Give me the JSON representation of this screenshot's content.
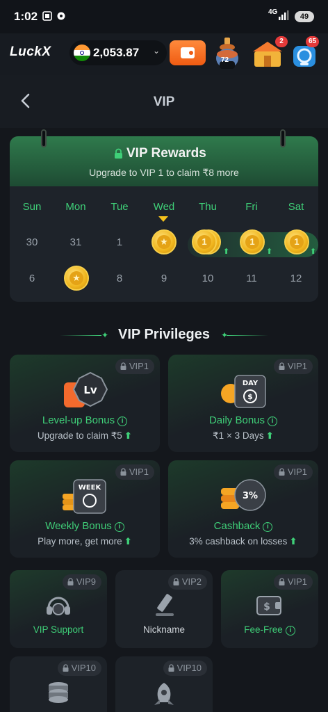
{
  "status_bar": {
    "time": "1:02",
    "network": "4G",
    "battery": "49"
  },
  "header": {
    "logo": "LuckX",
    "balance": "2,053.87",
    "level": "72",
    "gift_badge": "2",
    "support_badge": "65"
  },
  "nav": {
    "title": "VIP"
  },
  "rewards": {
    "title": "VIP Rewards",
    "subtitle": "Upgrade to VIP 1 to claim ₹8 more",
    "days": [
      "Sun",
      "Mon",
      "Tue",
      "Wed",
      "Thu",
      "Fri",
      "Sat"
    ],
    "week1": [
      "30",
      "31",
      "1"
    ],
    "week2": [
      "6",
      "8",
      "9",
      "10",
      "11",
      "12"
    ],
    "coin_values": [
      "1",
      "1",
      "1"
    ]
  },
  "privileges": {
    "title": "VIP Privileges",
    "cards": [
      {
        "name": "Level-up Bonus",
        "desc": "Upgrade to claim ₹5",
        "vip": "VIP1",
        "art": "Lv"
      },
      {
        "name": "Daily Bonus",
        "desc": "₹1 × 3 Days",
        "vip": "VIP1",
        "art": "DAY"
      },
      {
        "name": "Weekly Bonus",
        "desc": "Play more, get more",
        "vip": "VIP1",
        "art": "WEEK"
      },
      {
        "name": "Cashback",
        "desc": "3% cashback on losses",
        "vip": "VIP1",
        "art": "3%"
      }
    ],
    "small": [
      {
        "name": "VIP Support",
        "vip": "VIP9"
      },
      {
        "name": "Nickname",
        "vip": "VIP2"
      },
      {
        "name": "Fee-Free",
        "vip": "VIP1"
      },
      {
        "name": "",
        "vip": "VIP10"
      },
      {
        "name": "",
        "vip": "VIP10"
      }
    ]
  },
  "colors": {
    "accent": "#3fcf78",
    "background": "#14171c",
    "coin": "#f0b51d",
    "wallet": "#ef5b12"
  }
}
